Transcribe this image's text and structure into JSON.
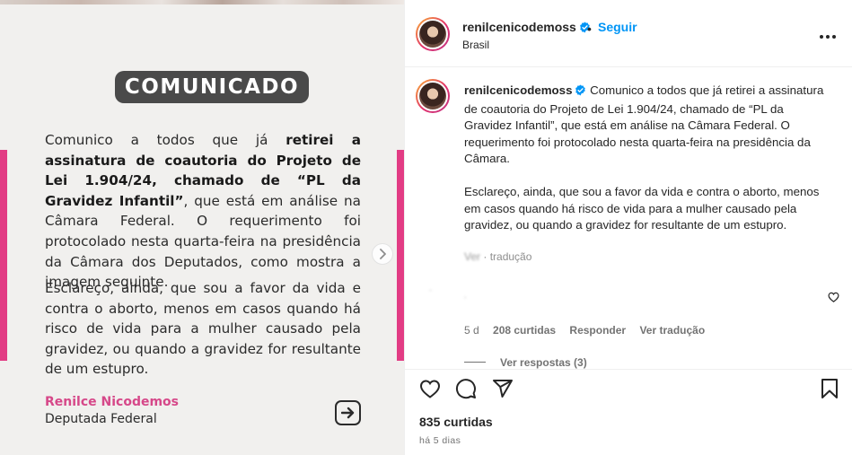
{
  "post": {
    "badge": "COMUNICADO",
    "para1": [
      {
        "text": "Comunico a todos que já ",
        "bold": false
      },
      {
        "text": "retirei a assinatura de coautoria do Projeto de Lei 1.904/24, chamado de “PL da Gravidez Infantil”",
        "bold": true
      },
      {
        "text": ", que está em análise na Câmara Federal. O requerimento foi protocolado nesta quarta-feira na presidência da Câmara dos Deputados, como mostra a imagem seguinte.",
        "bold": false
      }
    ],
    "para2": "Esclareço, ainda, que sou a favor da vida e contra o aborto, menos em casos quando há risco de vida para a mulher causado pela gravidez, ou quando a gravidez for resultante de um estupro.",
    "signature_name": "Renilce Nicodemos",
    "signature_role": "Deputada Federal"
  },
  "header": {
    "username": "renilcenicodemoss",
    "dot": "•",
    "follow_label": "Seguir",
    "location": "Brasil"
  },
  "caption": {
    "username": "renilcenicodemoss",
    "p1": "Comunico a todos que já retirei a assinatura de coautoria do Projeto de Lei 1.904/24, chamado de “PL da Gravidez Infantil”, que está em análise na Câmara Federal. O requerimento foi protocolado nesta quarta-feira na presidência da Câmara.",
    "p2": "Esclareço, ainda, que sou a favor da vida e contra o aborto, menos em casos quando há risco de vida para a mulher causado pela gravidez, ou quando a gravidez for resultante de um estupro.",
    "translation_prefix": "Ver",
    "translation_label": "tradução"
  },
  "comment": {
    "time": "5 d",
    "likes": "208 curtidas",
    "reply": "Responder",
    "translate": "Ver tradução",
    "view_replies": "Ver respostas (3)"
  },
  "footer": {
    "likes": "835 curtidas",
    "time_ago": "há 5 dias"
  },
  "colors": {
    "accent_blue": "#0095f6",
    "brand_pink": "#e23c84",
    "badge_gray": "#4a4a4a"
  },
  "icons": [
    "verified-icon",
    "more-options-icon",
    "heart-icon",
    "comment-icon",
    "share-icon",
    "bookmark-icon",
    "next-arrow-icon",
    "arrow-right-box-icon"
  ]
}
